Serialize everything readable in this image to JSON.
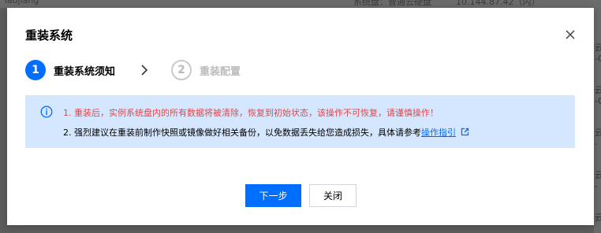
{
  "background": {
    "top_texts": [
      "laojiang",
      "系统盘：普通云硬盘",
      "10.144.87.42（内）"
    ],
    "right_texts": [
      "云",
      "-C",
      "云",
      "-C",
      "云",
      "-",
      "云",
      "-",
      "云"
    ]
  },
  "dialog": {
    "title": "重装系统",
    "close_icon": "close-icon",
    "steps": [
      {
        "number": "1",
        "label": "重装系统须知",
        "state": "active"
      },
      {
        "number": "2",
        "label": "重装配置",
        "state": "inactive"
      }
    ],
    "step_separator_icon": "chevron-right-icon",
    "notice": {
      "icon": "info-icon",
      "line1": "1. 重装后，实例系统盘内的所有数据将被清除，恢复到初始状态，该操作不可恢复，请谨慎操作！",
      "line2_prefix": "2. 强烈建议在重装前制作快照或镜像做好相关备份，以免数据丢失给您造成损失，具体请参考",
      "line2_link": "操作指引",
      "link_icon": "external-link-icon"
    },
    "buttons": {
      "next": "下一步",
      "close": "关闭"
    }
  },
  "colors": {
    "primary": "#006eff",
    "warning_text": "#e54545",
    "notice_bg": "#d5e7ff",
    "overlay": "#5c5c5c"
  }
}
